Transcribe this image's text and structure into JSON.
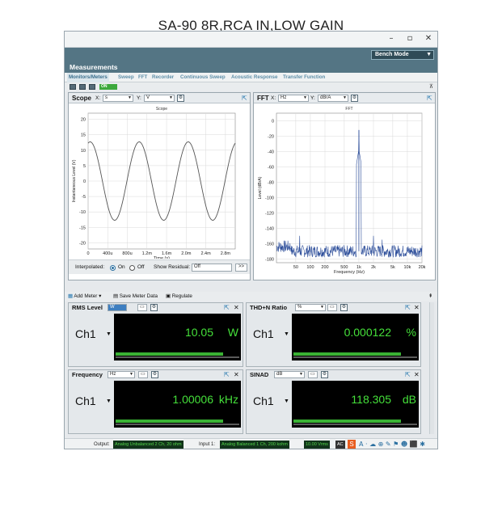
{
  "caption": "SA-90 8R,RCA IN,LOW GAIN",
  "window": {
    "minimize": "–",
    "maximize": "▫",
    "close": "✕"
  },
  "mode": {
    "label": "Bench Mode"
  },
  "measurements_title": "Measurements",
  "tabs": [
    "Monitors/Meters",
    "Sweep",
    "FFT",
    "Recorder",
    "Continuous Sweep",
    "Acoustic Response",
    "Transfer Function"
  ],
  "toolbar": {
    "on_label": "ON"
  },
  "scope": {
    "title": "Scope",
    "x_label": "X:",
    "x_unit": "s",
    "y_label": "Y:",
    "y_unit": "V",
    "options": {
      "interpolated_label": "Interpolated:",
      "on": "On",
      "off": "Off",
      "show_residual_label": "Show Residual:",
      "residual_value": "Off",
      "expand": ">>"
    }
  },
  "fft": {
    "title": "FFT",
    "x_label": "X:",
    "x_unit": "Hz",
    "y_label": "Y:",
    "y_unit": "dBrA"
  },
  "meter_toolbar": {
    "add_meter": "Add Meter",
    "save_meter_data": "Save Meter Data",
    "regulate": "Regulate"
  },
  "meters": [
    {
      "title": "RMS Level",
      "unit_select": "W",
      "channel": "Ch1",
      "value": "10.05",
      "unit": "W",
      "bar": 0.87
    },
    {
      "title": "THD+N Ratio",
      "unit_select": "%",
      "channel": "Ch1",
      "value": "0.000122",
      "unit": "%",
      "bar": 0.87
    },
    {
      "title": "Frequency",
      "unit_select": "Hz",
      "channel": "Ch1",
      "value": "1.00006",
      "unit": "kHz",
      "bar": 0.87
    },
    {
      "title": "SINAD",
      "unit_select": "dB",
      "channel": "Ch1",
      "value": "118.305",
      "unit": "dB",
      "bar": 0.87
    }
  ],
  "status": {
    "output_label": "Output:",
    "output_value": "Analog Unbalanced 2 Ch, 20 ohm",
    "input_label": "Input 1:",
    "input_value": "Analog Balanced 1 Ch, 200 kohm",
    "range_value": "10.00 Vrms",
    "coupling": "AC"
  },
  "chart_data": [
    {
      "type": "line",
      "title": "Scope",
      "xlabel": "Time (s)",
      "ylabel": "Instantaneous Level (V)",
      "x_ticks": [
        "0",
        "400u",
        "800u",
        "1.2m",
        "1.6m",
        "2.0m",
        "2.4m",
        "2.8m"
      ],
      "y_ticks": [
        "20",
        "15",
        "10",
        "5",
        "0",
        "-5",
        "-10",
        "-15",
        "-20"
      ],
      "xlim": [
        0,
        0.003
      ],
      "ylim": [
        -22,
        22
      ],
      "grid": true,
      "series": [
        {
          "frequency_hz": 1000,
          "amplitude_v": 12.7,
          "phase_deg": 75
        }
      ]
    },
    {
      "type": "line",
      "title": "FFT",
      "xlabel": "Frequency (Hz)",
      "ylabel": "Level (dBrA)",
      "x_ticks": [
        "50",
        "100",
        "200",
        "500",
        "1k",
        "2k",
        "5k",
        "10k",
        "20k"
      ],
      "y_ticks": [
        "0",
        "-20",
        "-40",
        "-60",
        "-80",
        "-100",
        "-120",
        "-140",
        "-160",
        "-180"
      ],
      "xlim": [
        20,
        20000
      ],
      "ylim": [
        -185,
        10
      ],
      "log_x": true,
      "grid": true,
      "peaks": [
        {
          "x": 1000,
          "y": -12
        },
        {
          "x": 60,
          "y": -150
        },
        {
          "x": 2000,
          "y": -150
        },
        {
          "x": 3000,
          "y": -155
        }
      ],
      "noise_floor": -170
    }
  ]
}
